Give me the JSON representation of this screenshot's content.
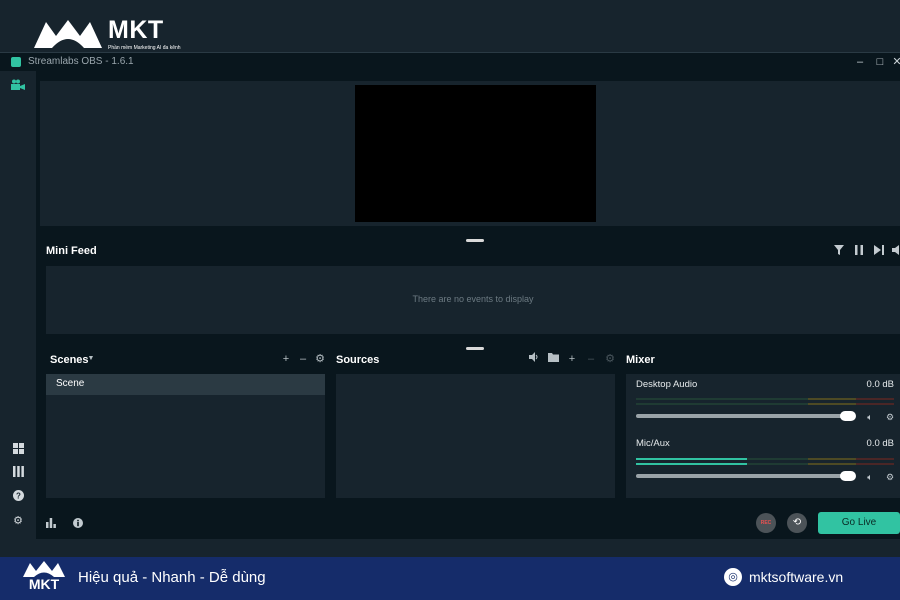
{
  "brand": {
    "name": "MKT",
    "tagline": "Phần mềm Marketing AI đa kênh",
    "slogan": "Hiệu quả - Nhanh - Dễ dùng",
    "website": "mktsoftware.vn"
  },
  "window": {
    "title": "Streamlabs OBS - 1.6.1",
    "controls": [
      "minimize",
      "maximize",
      "close"
    ]
  },
  "sidebar": {
    "top_icon": "studio-camera-icon",
    "bottom_icons": [
      "layout-icon",
      "themes-icon",
      "help-icon",
      "settings-icon"
    ]
  },
  "mini_feed": {
    "title": "Mini Feed",
    "empty_text": "There are no events to display",
    "controls": [
      "filter-icon",
      "pause-icon",
      "skip-icon",
      "mute-icon"
    ]
  },
  "scenes": {
    "title": "Scenes",
    "items": [
      {
        "label": "Scene"
      }
    ]
  },
  "sources": {
    "title": "Sources"
  },
  "mixer": {
    "title": "Mixer",
    "channels": [
      {
        "name": "Desktop Audio",
        "db": "0.0 dB",
        "level": 0,
        "volume": 1.0
      },
      {
        "name": "Mic/Aux",
        "db": "0.0 dB",
        "level": 0.43,
        "volume": 1.0
      }
    ]
  },
  "footer": {
    "rec_label": "REC",
    "go_live_label": "Go Live"
  },
  "colors": {
    "accent": "#31c3a2",
    "background": "#09161d",
    "panel": "#17242d",
    "brand_blue": "#152c6a"
  }
}
